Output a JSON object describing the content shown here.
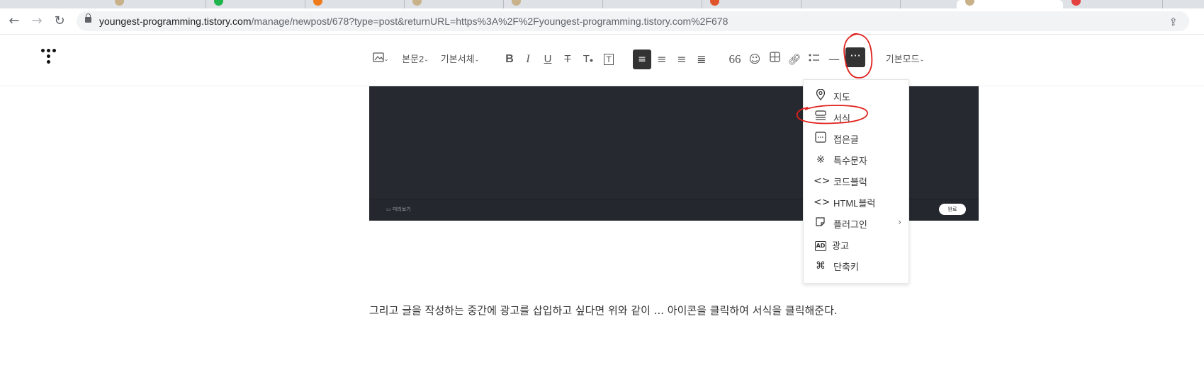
{
  "browser": {
    "url_host": "youngest-programming.tistory.com",
    "url_path": "/manage/newpost/678?type=post&returnURL=https%3A%2F%2Fyoungest-programming.tistory.com%2F678"
  },
  "toolbar": {
    "paragraph_style": "본문2",
    "font_face": "기본서체",
    "mode": "기본모드",
    "more_label": "···"
  },
  "image_bar": {
    "preview_label": "미리보기",
    "done_label": "완료"
  },
  "menu": {
    "items": [
      {
        "label": "지도",
        "icon": "map-pin-icon"
      },
      {
        "label": "서식",
        "icon": "template-icon"
      },
      {
        "label": "접은글",
        "icon": "fold-icon"
      },
      {
        "label": "특수문자",
        "icon": "special-char-icon"
      },
      {
        "label": "코드블럭",
        "icon": "code-icon"
      },
      {
        "label": "HTML블럭",
        "icon": "html-icon"
      },
      {
        "label": "플러그인",
        "icon": "plugin-icon",
        "has_submenu": true
      },
      {
        "label": "광고",
        "icon": "ad-icon"
      },
      {
        "label": "단축키",
        "icon": "shortcut-icon"
      }
    ]
  },
  "content": {
    "paragraph": "그리고 글을 작성하는 중간에 광고를 삽입하고 싶다면  위와 같이 ... 아이콘을 클릭하여 서식을 클릭해준다."
  },
  "colors": {
    "annotation": "#e0201b",
    "toolbar_active": "#333333"
  }
}
